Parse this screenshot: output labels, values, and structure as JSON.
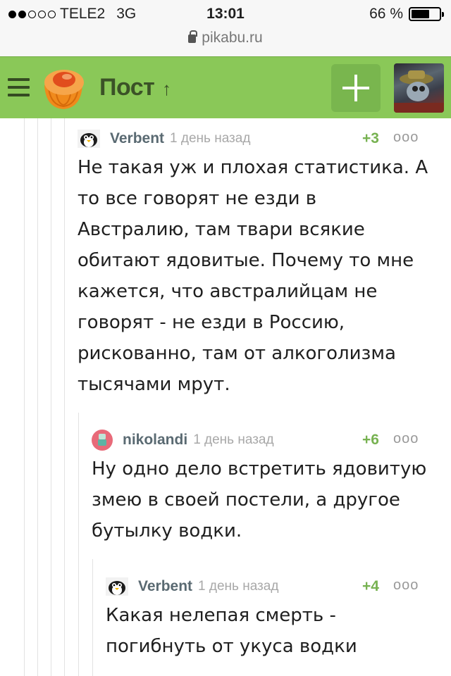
{
  "status_bar": {
    "carrier": "TELE2",
    "network": "3G",
    "time": "13:01",
    "battery": "66 %",
    "battery_level": 0.66
  },
  "address_bar": {
    "url": "pikabu.ru"
  },
  "header": {
    "title": "Пост",
    "accent_color": "#8ac858"
  },
  "comments": [
    {
      "author": "Verbent",
      "time": "1 день назад",
      "rating": "+3",
      "more": "ooo",
      "text_lines": [
        "Не такая уж и плохая статистика. А",
        "то все говорят не езди в",
        "Австралию, там твари всякие",
        "обитают ядовитые. Почему то мне",
        "кажется, что австралийцам не",
        "говорят - не езди в Россию,",
        "рискованно, там от алкоголизма",
        "тысячами мрут."
      ]
    },
    {
      "author": "nikolandi",
      "time": "1 день назад",
      "rating": "+6",
      "more": "ooo",
      "text_lines": [
        "Ну одно дело встретить ядовитую",
        "змею в своей постели, а другое",
        "бутылку водки."
      ]
    },
    {
      "author": "Verbent",
      "time": "1 день назад",
      "rating": "+4",
      "more": "ooo",
      "text_lines": [
        "Какая нелепая смерть -",
        "погибнуть от укуса водки"
      ]
    }
  ]
}
